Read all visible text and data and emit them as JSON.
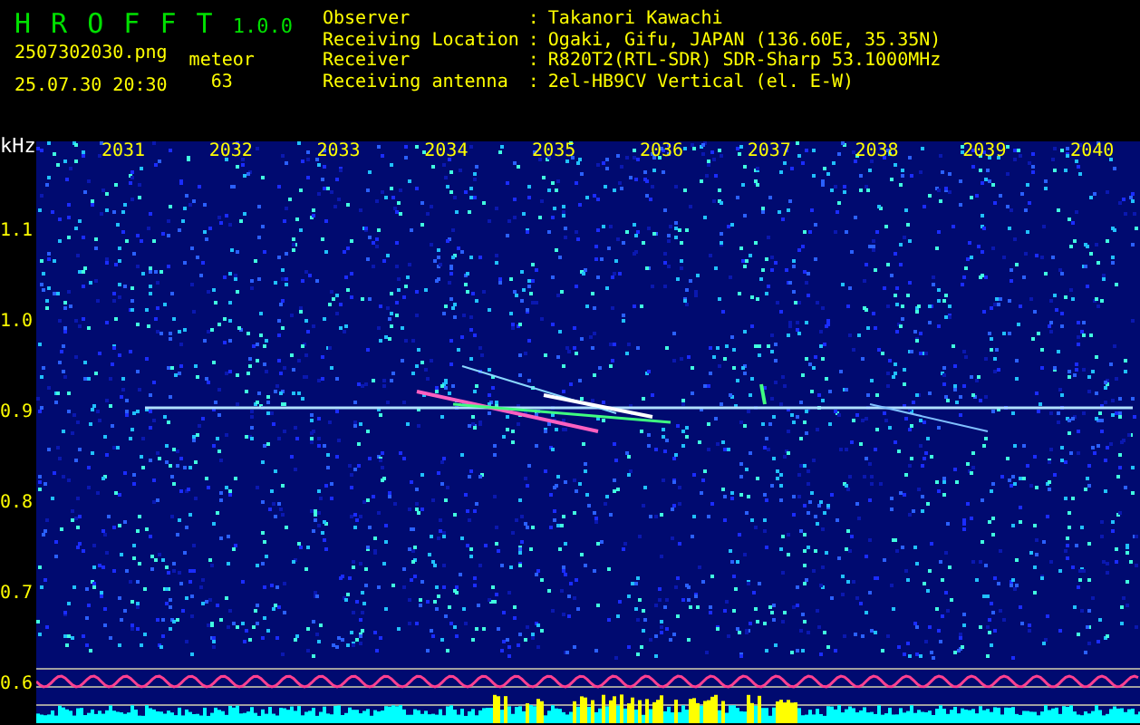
{
  "header": {
    "app_title": "H R O F F T",
    "version": "1.0.0",
    "filename": "2507302030.png",
    "datetime": "25.07.30 20:30",
    "meteor_label": "meteor",
    "meteor_count": "63"
  },
  "info": [
    {
      "label": "Observer",
      "separator": ":",
      "value": "Takanori Kawachi"
    },
    {
      "label": "Receiving Location",
      "separator": ":",
      "value": "Ogaki, Gifu, JAPAN (136.60E, 35.35N)"
    },
    {
      "label": "Receiver",
      "separator": ":",
      "value": "R820T2(RTL-SDR) SDR-Sharp 53.1000MHz"
    },
    {
      "label": "Receiving antenna",
      "separator": ":",
      "value": "2el-HB9CV Vertical (el. E-W)"
    }
  ],
  "spectrogram": {
    "y_unit": "kHz",
    "x_labels": [
      "2031",
      "2032",
      "2033",
      "2034",
      "2035",
      "2036",
      "2037",
      "2038",
      "2039",
      "2040"
    ],
    "y_labels": [
      "1.1",
      "1.0",
      "0.9",
      "0.8",
      "0.7",
      "0.6"
    ]
  }
}
